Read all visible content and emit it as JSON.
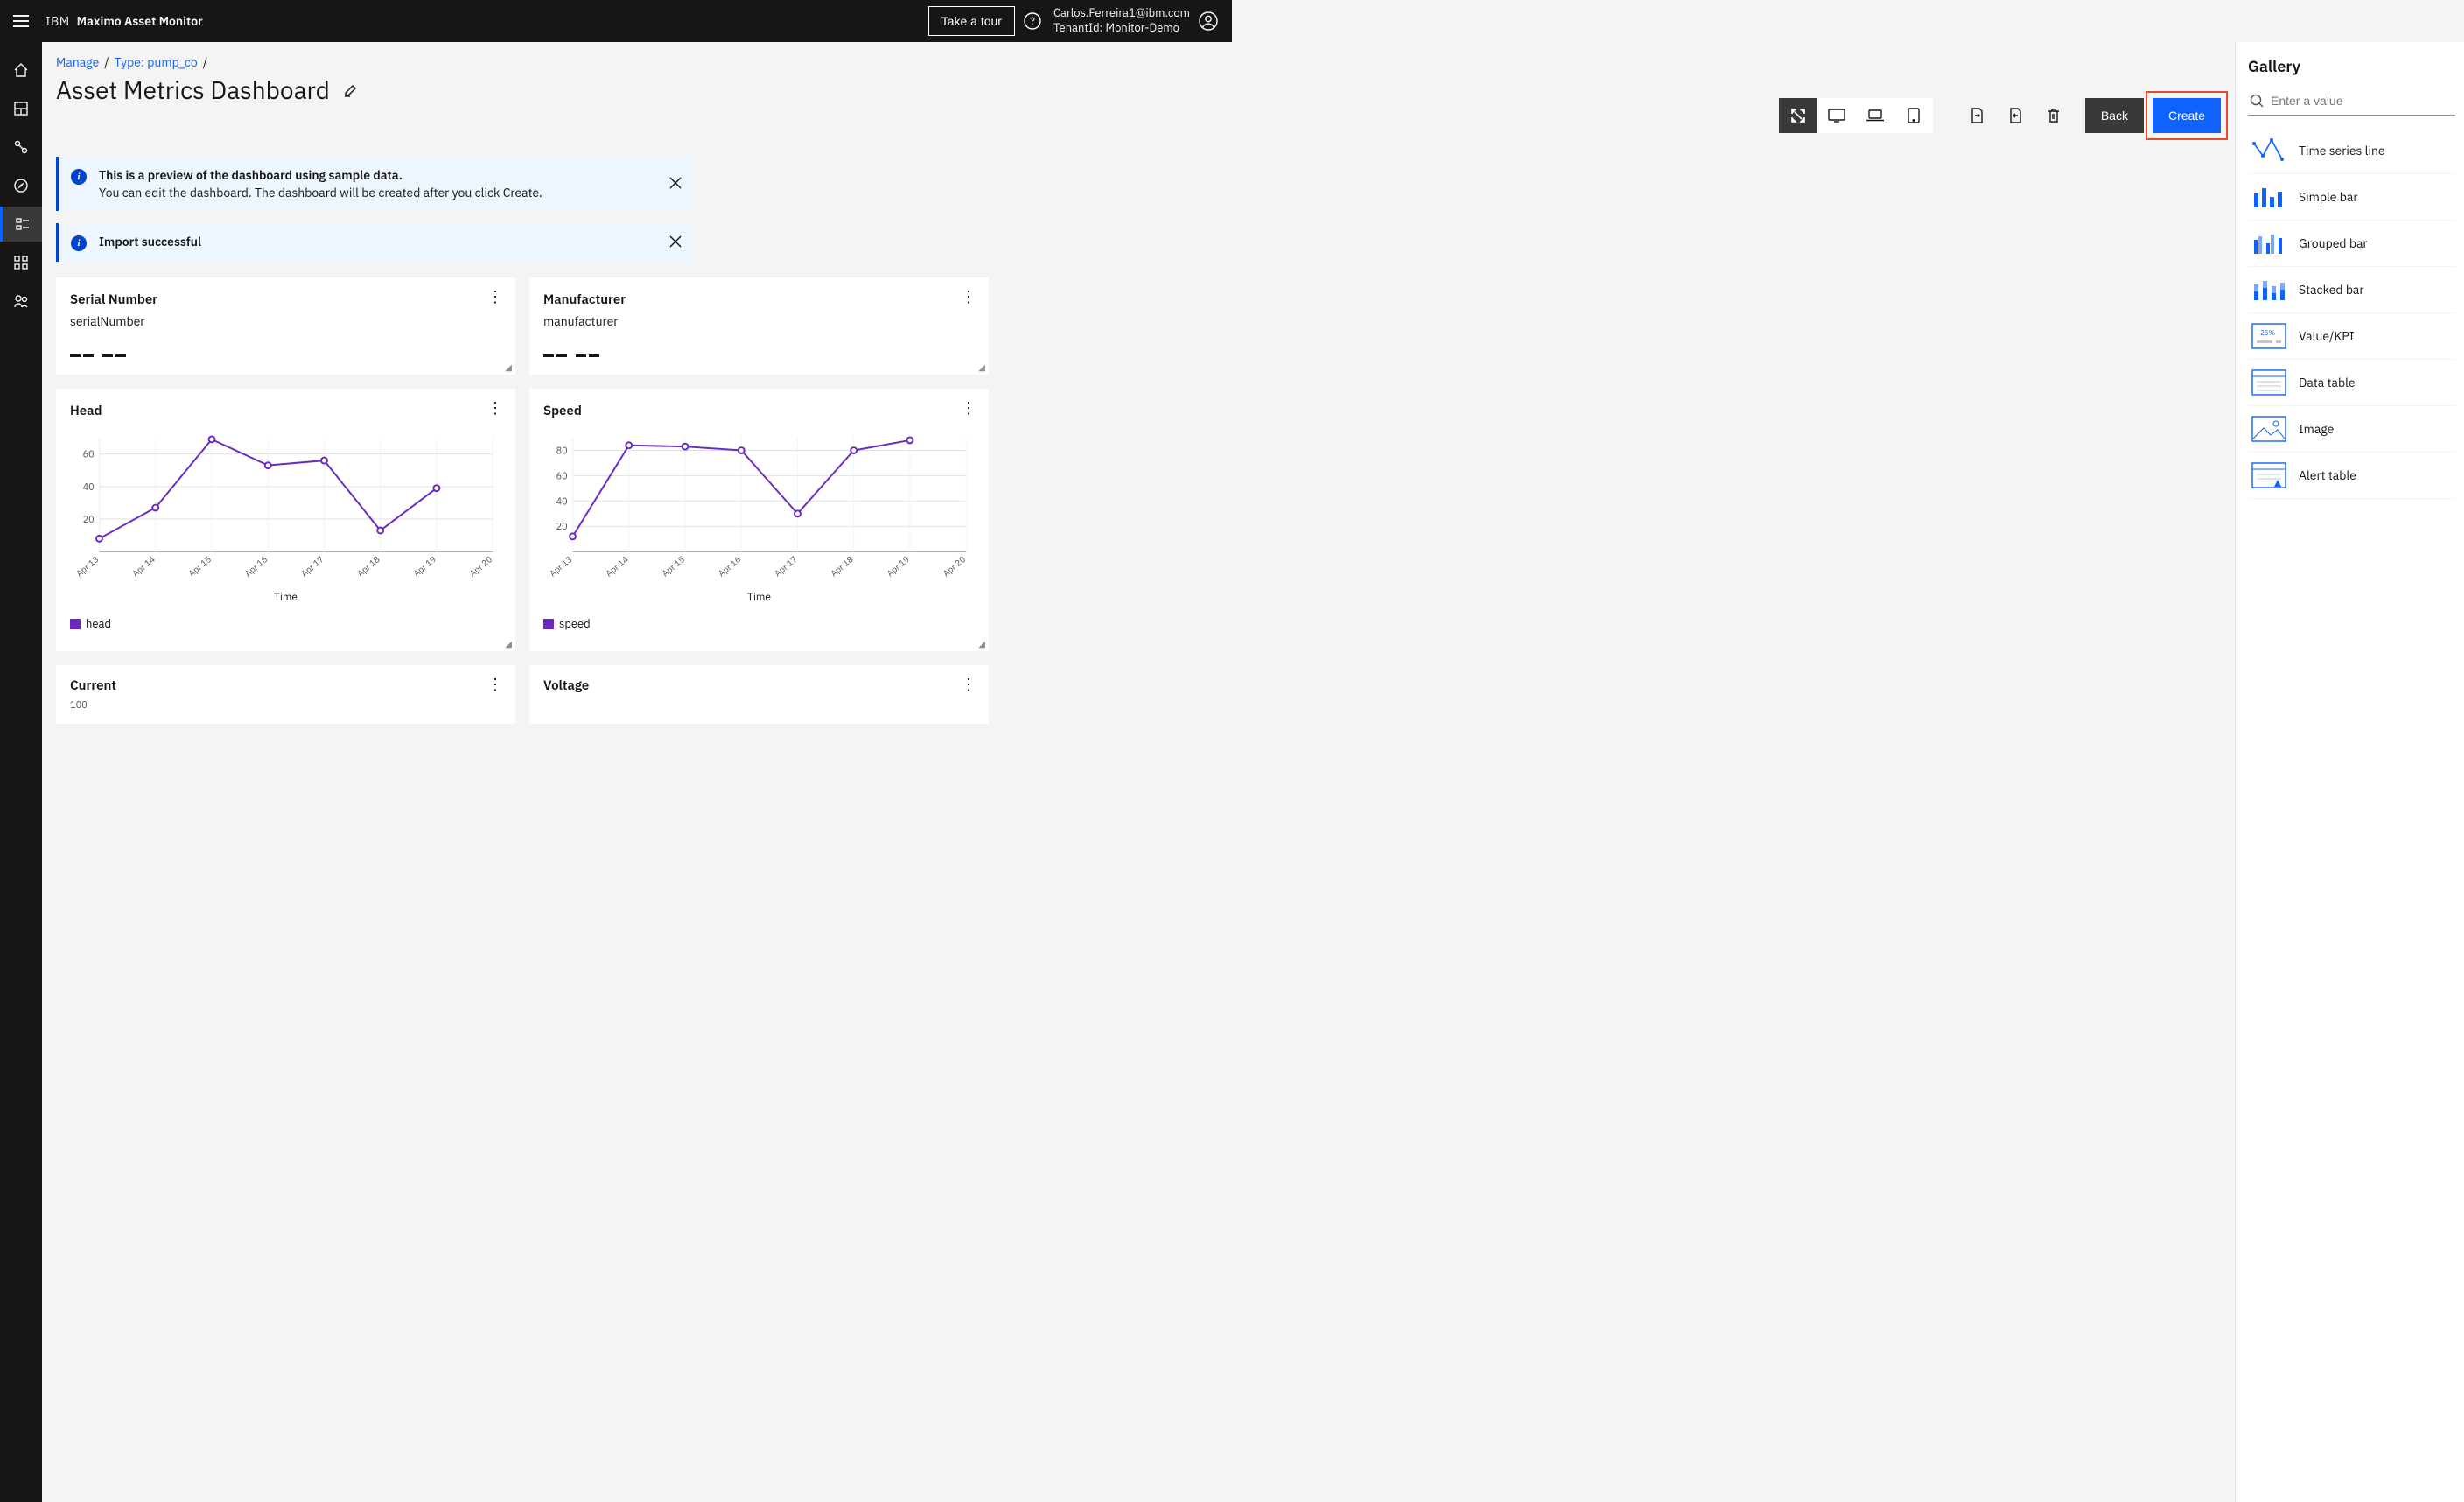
{
  "header": {
    "brand_prefix": "IBM",
    "brand_product": "Maximo Asset Monitor",
    "tour_label": "Take a tour",
    "user_email": "Carlos.Ferreira1@ibm.com",
    "tenant_line": "TenantId: Monitor-Demo"
  },
  "breadcrumb": {
    "items": [
      "Manage",
      "Type: pump_co"
    ]
  },
  "page": {
    "title": "Asset Metrics Dashboard",
    "back_label": "Back",
    "create_label": "Create"
  },
  "notifications": [
    {
      "title": "This is a preview of the dashboard using sample data.",
      "body": "You can edit the dashboard. The dashboard will be created after you click Create."
    },
    {
      "title": "Import successful",
      "body": ""
    }
  ],
  "cards": {
    "serial": {
      "title": "Serial Number",
      "sub": "serialNumber",
      "value": "— —"
    },
    "manufacturer": {
      "title": "Manufacturer",
      "sub": "manufacturer",
      "value": "— —"
    },
    "head": {
      "title": "Head",
      "legend": "head",
      "xlabel": "Time"
    },
    "speed": {
      "title": "Speed",
      "legend": "speed",
      "xlabel": "Time"
    },
    "current": {
      "title": "Current",
      "y0": "100"
    },
    "voltage": {
      "title": "Voltage"
    }
  },
  "gallery": {
    "title": "Gallery",
    "search_placeholder": "Enter a value",
    "items": [
      "Time series line",
      "Simple bar",
      "Grouped bar",
      "Stacked bar",
      "Value/KPI",
      "Data table",
      "Image",
      "Alert table"
    ]
  },
  "chart_data": [
    {
      "name": "Head",
      "type": "line",
      "title": "Head",
      "xlabel": "Time",
      "ylabel": "",
      "categories": [
        "Apr 13",
        "Apr 14",
        "Apr 15",
        "Apr 16",
        "Apr 17",
        "Apr 18",
        "Apr 19",
        "Apr 20"
      ],
      "series": [
        {
          "name": "head",
          "values": [
            8,
            27,
            69,
            53,
            56,
            13,
            39,
            null
          ]
        }
      ],
      "ylim": [
        0,
        70
      ],
      "yticks": [
        20,
        40,
        60
      ],
      "color": "#6929c4"
    },
    {
      "name": "Speed",
      "type": "line",
      "title": "Speed",
      "xlabel": "Time",
      "ylabel": "",
      "categories": [
        "Apr 13",
        "Apr 14",
        "Apr 15",
        "Apr 16",
        "Apr 17",
        "Apr 18",
        "Apr 19",
        "Apr 20"
      ],
      "series": [
        {
          "name": "speed",
          "values": [
            12,
            84,
            83,
            80,
            30,
            80,
            88,
            null
          ]
        }
      ],
      "ylim": [
        0,
        90
      ],
      "yticks": [
        20,
        40,
        60,
        80
      ],
      "color": "#6929c4"
    },
    {
      "name": "Current",
      "type": "line",
      "title": "Current",
      "xlabel": "",
      "ylabel": "",
      "categories": [],
      "series": [],
      "ylim": [
        0,
        100
      ],
      "yticks": [
        100
      ],
      "color": "#6929c4"
    }
  ]
}
